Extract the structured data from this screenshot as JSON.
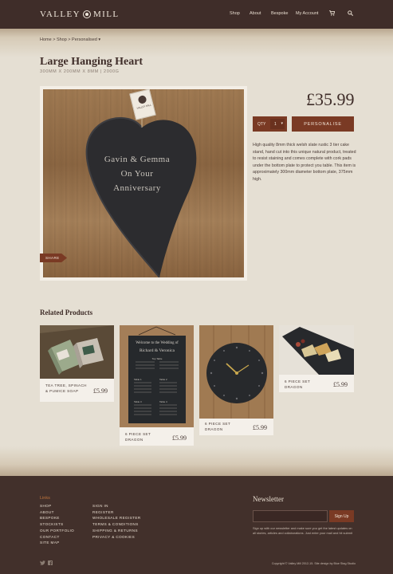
{
  "header": {
    "logo": "VALLEY MILL",
    "nav": [
      "Shop",
      "About",
      "Bespoke",
      "My Account"
    ],
    "icons": [
      "cart-icon",
      "search-icon"
    ]
  },
  "breadcrumb": "Home > Shop > Personalised",
  "product": {
    "title": "Large Hanging Heart",
    "subtitle": "300MM X 200MM X 8MM | 2000G",
    "engraving": [
      "Gavin & Gemma",
      "On Your",
      "Anniversary"
    ],
    "tag_text": "VALLEY MILL",
    "share_label": "SHARE",
    "price": "£35.99",
    "qty_label": "QTY",
    "qty_value": "1",
    "personalise_label": "PERSONALISE",
    "description": "High quality 8mm thick welsh slate rustic 3 tier cake stand, hand cut into this unique natural product, treated to resist staining and comes complete with cork pads under the bottom plate to protect you table. This item is approximately 300mm diameter bottom plate, 375mm high."
  },
  "related": {
    "title": "Related Products",
    "items": [
      {
        "name": "TEA TREE, SPINACH & PUMICE SOAP",
        "price": "£5.99"
      },
      {
        "name": "6 PIECE SET DRAGON",
        "price": "£5.99",
        "sign_lines": [
          "Welcome to the Wedding of",
          "Richard & Veronica",
          "Top Table",
          "Table 1",
          "Table 2",
          "Table 3",
          "Table 4"
        ]
      },
      {
        "name": "6 PIECE SET DRAGON",
        "price": "£5.99"
      },
      {
        "name": "6 PIECE SET DRAGON",
        "price": "£5.99"
      }
    ]
  },
  "footer": {
    "links_title": "Links",
    "col1": [
      "SHOP",
      "ABOUT",
      "BESPOKE",
      "STOCKISTS",
      "OUR PORTFOLIO",
      "CONTACT",
      "SITE MAP"
    ],
    "col2": [
      "SIGN IN",
      "REGISTER",
      "WHOLESALE REGISTER",
      "TERMS & CONDITIONS",
      "SHIPPING & RETURNS",
      "PRIVACY & COOKIES"
    ],
    "newsletter_title": "Newsletter",
    "newsletter_placeholder": "",
    "signup_label": "Sign Up",
    "newsletter_text": "Sign up with our newsletter and make sure you get the latest updates on all stories, articles and collaborations. Just enter your mail and hit submit",
    "copyright": "Copyright © Valley Mill 2012-15. Site design by Blue Stag Studio",
    "social": [
      "twitter-icon",
      "facebook-icon"
    ]
  },
  "colors": {
    "header_bg": "#3f2d29",
    "accent": "#7a3a24",
    "page_bg": "#e5dfd3",
    "link_accent": "#c0743c"
  }
}
